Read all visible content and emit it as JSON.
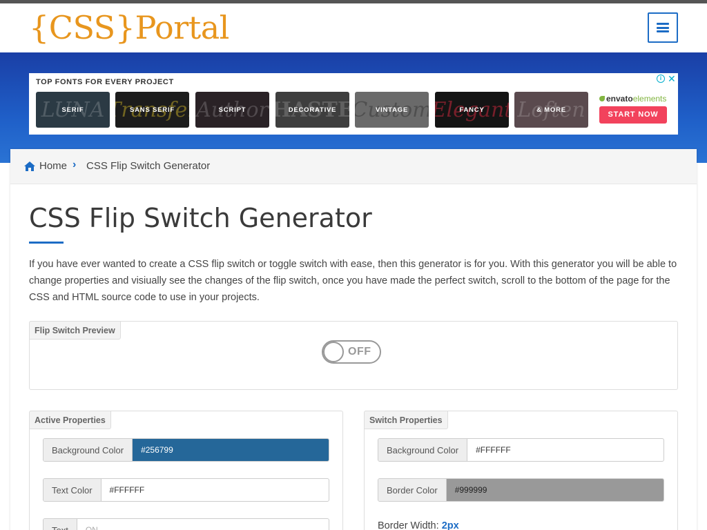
{
  "header": {
    "logo_text": "{CSS}Portal",
    "menu_icon": "hamburger-menu-icon"
  },
  "ad": {
    "title": "TOP FONTS FOR EVERY PROJECT",
    "tiles": [
      {
        "label": "SERIF",
        "color": "#2b3a44",
        "deco": "LUNA"
      },
      {
        "label": "SANS SERIF",
        "color": "#1c1c1c",
        "deco": "Transfer"
      },
      {
        "label": "SCRIPT",
        "color": "#2a2226",
        "deco": "Author"
      },
      {
        "label": "DECORATIVE",
        "color": "#3e3e3e",
        "deco": "HASTE"
      },
      {
        "label": "VINTAGE",
        "color": "#6a6a6a",
        "deco": "Custom"
      },
      {
        "label": "FANCY",
        "color": "#141414",
        "deco": "Elegant"
      },
      {
        "label": "& MORE",
        "color": "#5a4a4e",
        "deco": "Loften"
      }
    ],
    "brand_main": "envato",
    "brand_sub": "elements",
    "cta": "START NOW"
  },
  "breadcrumb": {
    "home": "Home",
    "separator": "›",
    "current": "CSS Flip Switch Generator"
  },
  "page": {
    "title": "CSS Flip Switch Generator",
    "intro": "If you have ever wanted to create a CSS flip switch or toggle switch with ease, then this generator is for you. With this generator you will be able to change properties and visiually see the changes of the flip switch, once you have made the perfect switch, scroll to the bottom of the page for the CSS and HTML source code to use in your projects."
  },
  "preview": {
    "tag": "Flip Switch Preview",
    "switch_text": "OFF"
  },
  "active_properties": {
    "tag": "Active Properties",
    "bg_label": "Background Color",
    "bg_value": "#256799",
    "bg_color": "#256799",
    "text_color_label": "Text Color",
    "text_color_value": "#FFFFFF",
    "text_label": "Text",
    "text_placeholder": "ON"
  },
  "switch_properties": {
    "tag": "Switch Properties",
    "bg_label": "Background Color",
    "bg_value": "#FFFFFF",
    "border_label": "Border Color",
    "border_value": "#999999",
    "border_color": "#999999",
    "border_width_label": "Border Width:",
    "border_width_value": "2px"
  },
  "colors": {
    "accent": "#1c6cc5",
    "logo": "#e8961e",
    "cta": "#f2425c"
  }
}
